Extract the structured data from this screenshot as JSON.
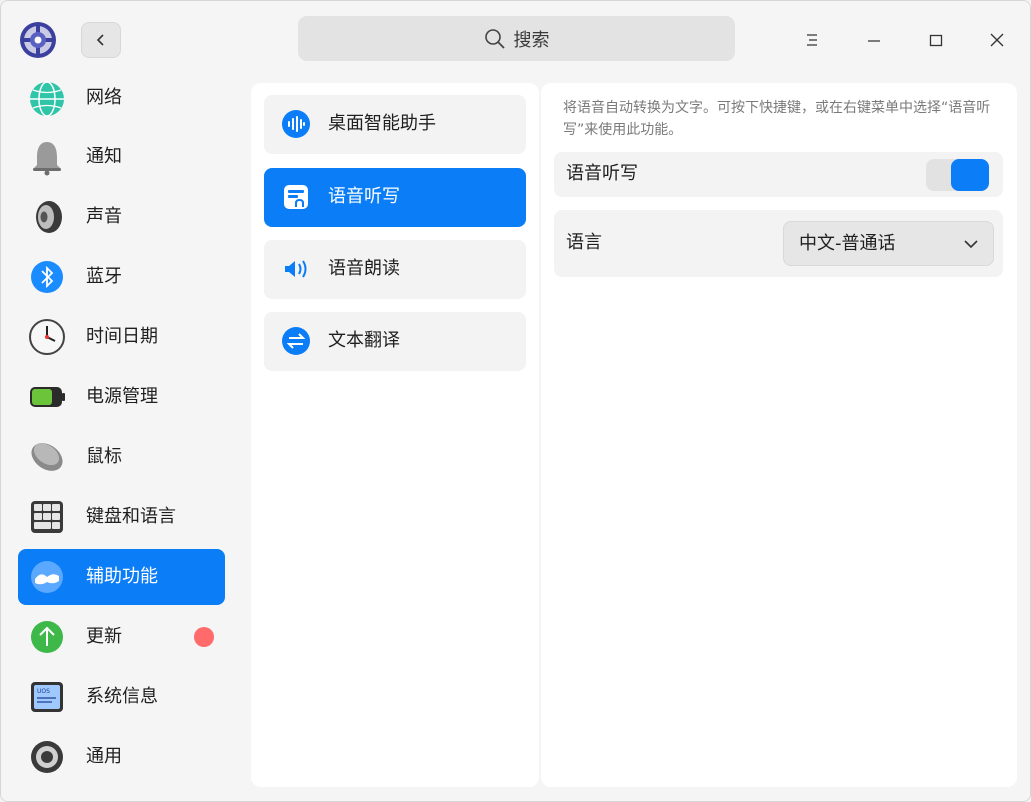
{
  "window": {
    "search_placeholder": "搜索",
    "icons": {
      "logo": "settings-logo-icon",
      "back": "chevron-left-icon",
      "search": "search-icon",
      "menu": "menu-icon",
      "minimize": "minimize-icon",
      "maximize": "maximize-icon",
      "close": "close-icon"
    }
  },
  "sidebar": {
    "items": [
      {
        "label": "网络",
        "icon": "network-icon"
      },
      {
        "label": "通知",
        "icon": "bell-icon"
      },
      {
        "label": "声音",
        "icon": "speaker-icon"
      },
      {
        "label": "蓝牙",
        "icon": "bluetooth-icon"
      },
      {
        "label": "时间日期",
        "icon": "clock-icon"
      },
      {
        "label": "电源管理",
        "icon": "battery-icon"
      },
      {
        "label": "鼠标",
        "icon": "mouse-icon"
      },
      {
        "label": "键盘和语言",
        "icon": "keyboard-icon"
      },
      {
        "label": "辅助功能",
        "icon": "accessibility-icon",
        "active": true
      },
      {
        "label": "更新",
        "icon": "update-icon",
        "badge": true
      },
      {
        "label": "系统信息",
        "icon": "system-info-icon"
      },
      {
        "label": "通用",
        "icon": "general-icon"
      }
    ]
  },
  "sub_menu": {
    "items": [
      {
        "label": "桌面智能助手",
        "icon": "voice-wave-icon"
      },
      {
        "label": "语音听写",
        "icon": "dictation-icon",
        "active": true
      },
      {
        "label": "语音朗读",
        "icon": "read-aloud-icon"
      },
      {
        "label": "文本翻译",
        "icon": "translate-icon"
      }
    ]
  },
  "detail": {
    "description": "将语音自动转换为文字。可按下快捷键，或在右键菜单中选择“语音听写”来使用此功能。",
    "dictation_label": "语音听写",
    "dictation_enabled": true,
    "language_label": "语言",
    "language_value": "中文-普通话"
  },
  "colors": {
    "accent": "#0a7df7",
    "badge": "#ff6b6b"
  }
}
